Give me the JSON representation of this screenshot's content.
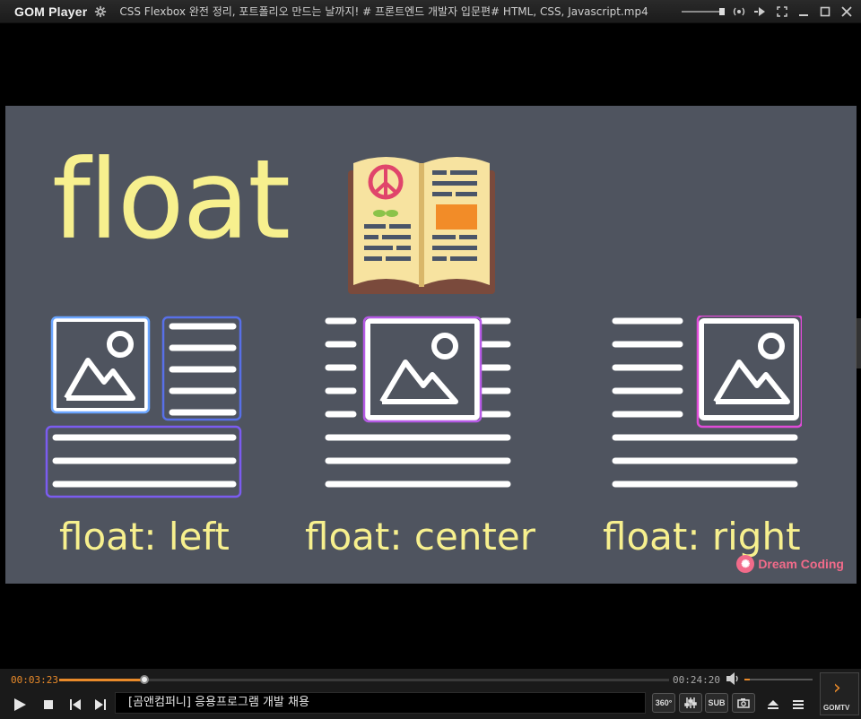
{
  "titlebar": {
    "brand": "GOM Player",
    "title": "CSS Flexbox 완전 정리, 포트폴리오 만드는 날까지! # 프론트엔드 개발자 입문편# HTML, CSS, Javascript.mp4",
    "icons": [
      "gear-icon",
      "audio-icon",
      "play-pause-icon",
      "fullscreen-icon",
      "minimize-icon",
      "maximize-icon",
      "close-icon"
    ]
  },
  "slide": {
    "heading": "float",
    "captions": {
      "left": "float: left",
      "center": "float: center",
      "right": "float: right"
    },
    "watermark": "Dream Coding",
    "colors": {
      "background": "#4f545f",
      "text": "#f7f08e",
      "left_box": "#5b8cf0",
      "center_box": "#b65ae6",
      "right_box": "#e04bd8"
    }
  },
  "controls": {
    "current_time": "00:03:23",
    "total_time": "00:24:20",
    "progress": 0.139,
    "volume": 0.08,
    "ticker": "[곰앤컴퍼니] 응용프로그램 개발 채용",
    "buttons": {
      "play": "play-icon",
      "stop": "stop-icon",
      "prev": "prev-icon",
      "next": "next-icon",
      "vr360": "360°",
      "sub": "SUB",
      "capture": "camera-icon",
      "eject": "eject-icon",
      "menu": "menu-icon"
    },
    "gomtv_label": "GOMTV"
  }
}
